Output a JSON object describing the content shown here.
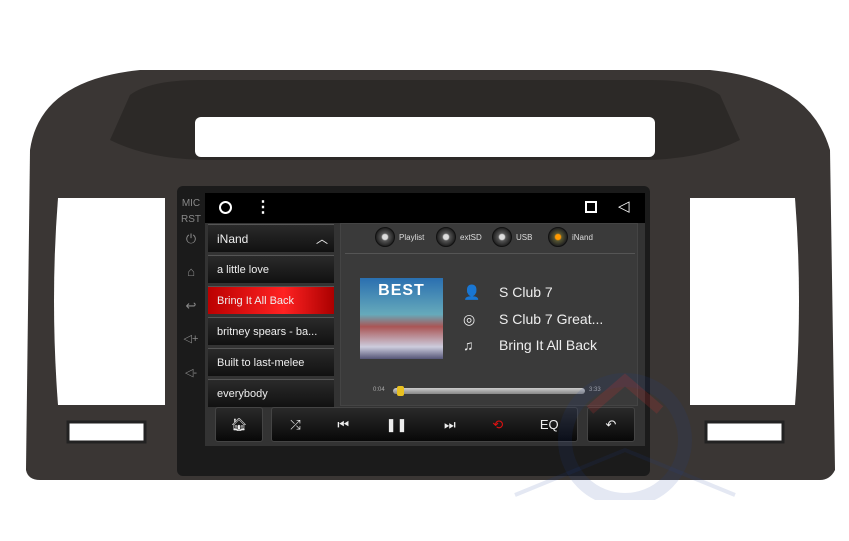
{
  "side_labels": {
    "mic": "MIC",
    "rst": "RST"
  },
  "side_icons": [
    "power-icon",
    "home-icon",
    "back-icon",
    "volume-up-icon",
    "volume-down-icon"
  ],
  "list": {
    "header": "iNand",
    "items": [
      "a little love",
      "Bring It All Back",
      "britney spears - ba...",
      "Built to last-melee",
      "everybody"
    ],
    "active_index": 1
  },
  "sources": [
    {
      "label": "Playlist",
      "active": false
    },
    {
      "label": "extSD",
      "active": false
    },
    {
      "label": "USB",
      "active": false
    },
    {
      "label": "iNand",
      "active": true
    }
  ],
  "album_art_text": "BEST",
  "now_playing": {
    "artist": "S Club 7",
    "album": "S Club 7 Great...",
    "title": "Bring It All Back"
  },
  "progress": {
    "elapsed": "0:04",
    "total": "3:33",
    "fraction": 0.02
  },
  "controls": {
    "eq": "EQ"
  },
  "colors": {
    "accent_red": "#e01010",
    "active_source": "#f0a000",
    "progress_thumb": "#e8c020"
  }
}
